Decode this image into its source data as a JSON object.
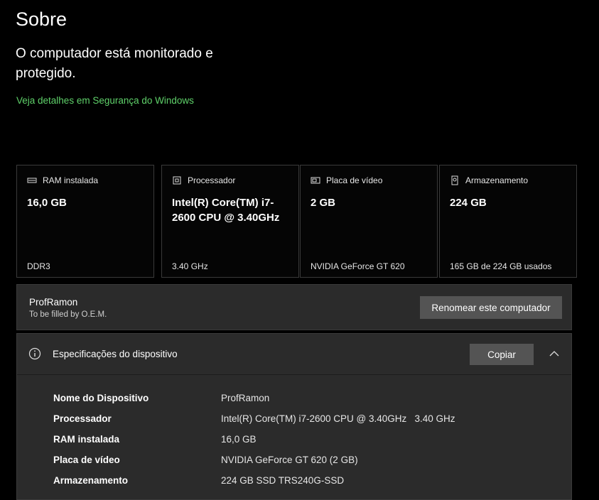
{
  "page": {
    "title": "Sobre",
    "status": "O computador está monitorado e protegido.",
    "link": "Veja detalhes em Segurança do Windows"
  },
  "cards": [
    {
      "label": "RAM instalada",
      "value": "16,0 GB",
      "sub": "DDR3",
      "icon": "ram-icon"
    },
    {
      "label": "Processador",
      "value": "Intel(R) Core(TM) i7-2600 CPU @ 3.40GHz",
      "sub": "3.40 GHz",
      "icon": "cpu-icon"
    },
    {
      "label": "Placa de vídeo",
      "value": "2 GB",
      "sub": "NVIDIA GeForce GT 620",
      "icon": "gpu-icon"
    },
    {
      "label": "Armazenamento",
      "value": "224 GB",
      "sub": "165 GB de 224 GB usados",
      "icon": "storage-icon"
    }
  ],
  "device": {
    "name": "ProfRamon",
    "oem": "To be filled by O.E.M.",
    "rename_button": "Renomear este computador"
  },
  "specs": {
    "title": "Especificações do dispositivo",
    "copy_button": "Copiar",
    "rows": [
      {
        "key": "Nome do Dispositivo",
        "value": "ProfRamon"
      },
      {
        "key": "Processador",
        "value": "Intel(R) Core(TM) i7-2600 CPU @ 3.40GHz   3.40 GHz"
      },
      {
        "key": "RAM instalada",
        "value": "16,0 GB"
      },
      {
        "key": "Placa de vídeo",
        "value": "NVIDIA GeForce GT 620 (2 GB)"
      },
      {
        "key": "Armazenamento",
        "value": "224 GB SSD TRS240G-SSD"
      }
    ]
  },
  "colors": {
    "link": "#5fd16a",
    "panel": "#2b2b2b",
    "button": "#545454"
  }
}
